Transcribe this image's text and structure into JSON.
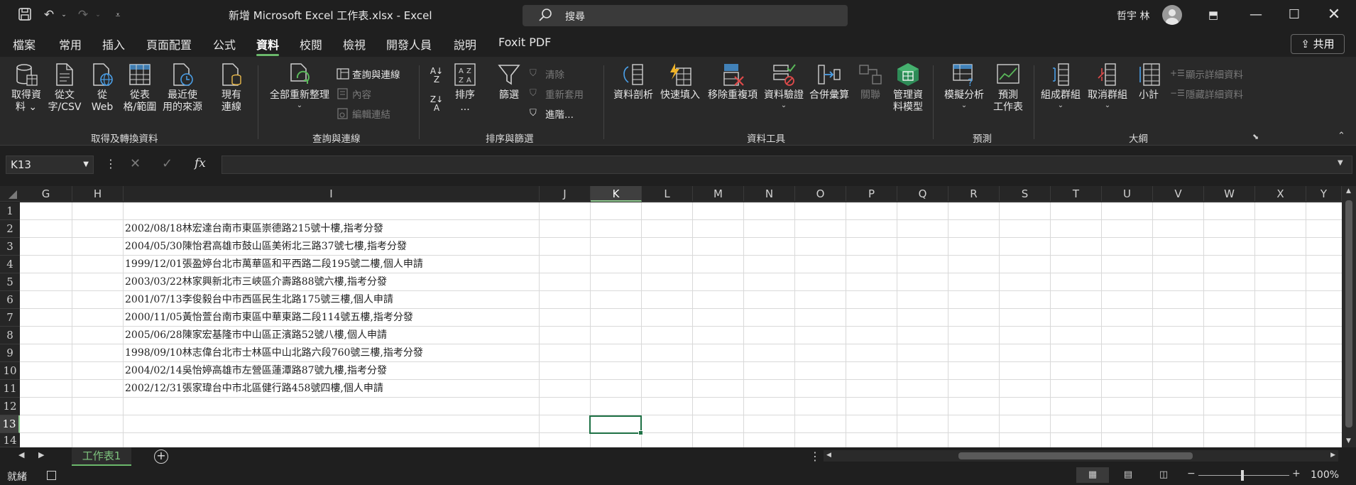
{
  "titlebar": {
    "doc_title": "新增 Microsoft Excel 工作表.xlsx  -  Excel",
    "search_placeholder": "搜尋",
    "user_name": "哲宇 林"
  },
  "menu": {
    "tabs": [
      "檔案",
      "常用",
      "插入",
      "頁面配置",
      "公式",
      "資料",
      "校閱",
      "檢視",
      "開發人員",
      "說明",
      "Foxit PDF"
    ],
    "active_tab": "資料",
    "share_label": "共用"
  },
  "ribbon": {
    "get_data": {
      "line1": "取得資",
      "line2": "料"
    },
    "from_text": {
      "line1": "從文",
      "line2": "字/CSV"
    },
    "from_web": {
      "line1": "從",
      "line2": "Web"
    },
    "from_table": {
      "line1": "從表",
      "line2": "格/範圍"
    },
    "recent_sources": {
      "line1": "最近使",
      "line2": "用的來源"
    },
    "existing_conn": {
      "line1": "現有",
      "line2": "連線"
    },
    "group_get_transform": "取得及轉換資料",
    "refresh_all": "全部重新整理",
    "queries_conn": "查詢與連線",
    "properties": "內容",
    "edit_links": "編輯連結",
    "group_queries": "查詢與連線",
    "sort": {
      "line1": "排序",
      "line2": "..."
    },
    "filter": "篩選",
    "clear": "清除",
    "reapply": "重新套用",
    "advanced": "進階...",
    "group_sort_filter": "排序與篩選",
    "text_to_columns": "資料剖析",
    "flash_fill": "快速填入",
    "remove_duplicates": "移除重複項",
    "data_validation": "資料驗證",
    "consolidate": "合併彙算",
    "relationships": "關聯",
    "data_model": {
      "line1": "管理資",
      "line2": "料模型"
    },
    "group_data_tools": "資料工具",
    "what_if": "模擬分析",
    "forecast_sheet": {
      "line1": "預測",
      "line2": "工作表"
    },
    "group_forecast": "預測",
    "group": "組成群組",
    "ungroup": "取消群組",
    "subtotal": "小計",
    "show_detail": "顯示詳細資料",
    "hide_detail": "隱藏詳細資料",
    "group_outline": "大綱"
  },
  "formula_bar": {
    "name_box": "K13",
    "fx_label": "fx",
    "formula": ""
  },
  "grid": {
    "columns": [
      "G",
      "H",
      "I",
      "J",
      "K",
      "L",
      "M",
      "N",
      "O",
      "P",
      "Q",
      "R",
      "S",
      "T",
      "U",
      "V",
      "W",
      "X",
      "Y"
    ],
    "selected_column": "K",
    "rows": [
      "1",
      "2",
      "3",
      "4",
      "5",
      "6",
      "7",
      "8",
      "9",
      "10",
      "11",
      "12",
      "13",
      "14"
    ],
    "selected_cell": "K13",
    "column_I_values": [
      "",
      "2002/08/18林宏達台南市東區崇德路215號十樓,指考分發",
      "2004/05/30陳怡君高雄市鼓山區美術北三路37號七樓,指考分發",
      "1999/12/01張盈婷台北市萬華區和平西路二段195號二樓,個人申請",
      "2003/03/22林家興新北市三峽區介壽路88號六樓,指考分發",
      "2001/07/13李俊毅台中市西區民生北路175號三樓,個人申請",
      "2000/11/05黃怡萱台南市東區中華東路二段114號五樓,指考分發",
      "2005/06/28陳家宏基隆市中山區正濱路52號八樓,個人申請",
      "1998/09/10林志偉台北市士林區中山北路六段760號三樓,指考分發",
      "2004/02/14吳怡婷高雄市左營區蓮潭路87號九樓,指考分發",
      "2002/12/31張家瑋台中市北區健行路458號四樓,個人申請",
      "",
      "",
      ""
    ]
  },
  "sheet_tabs": {
    "active": "工作表1"
  },
  "status": {
    "mode": "就緒",
    "zoom": "100%"
  }
}
